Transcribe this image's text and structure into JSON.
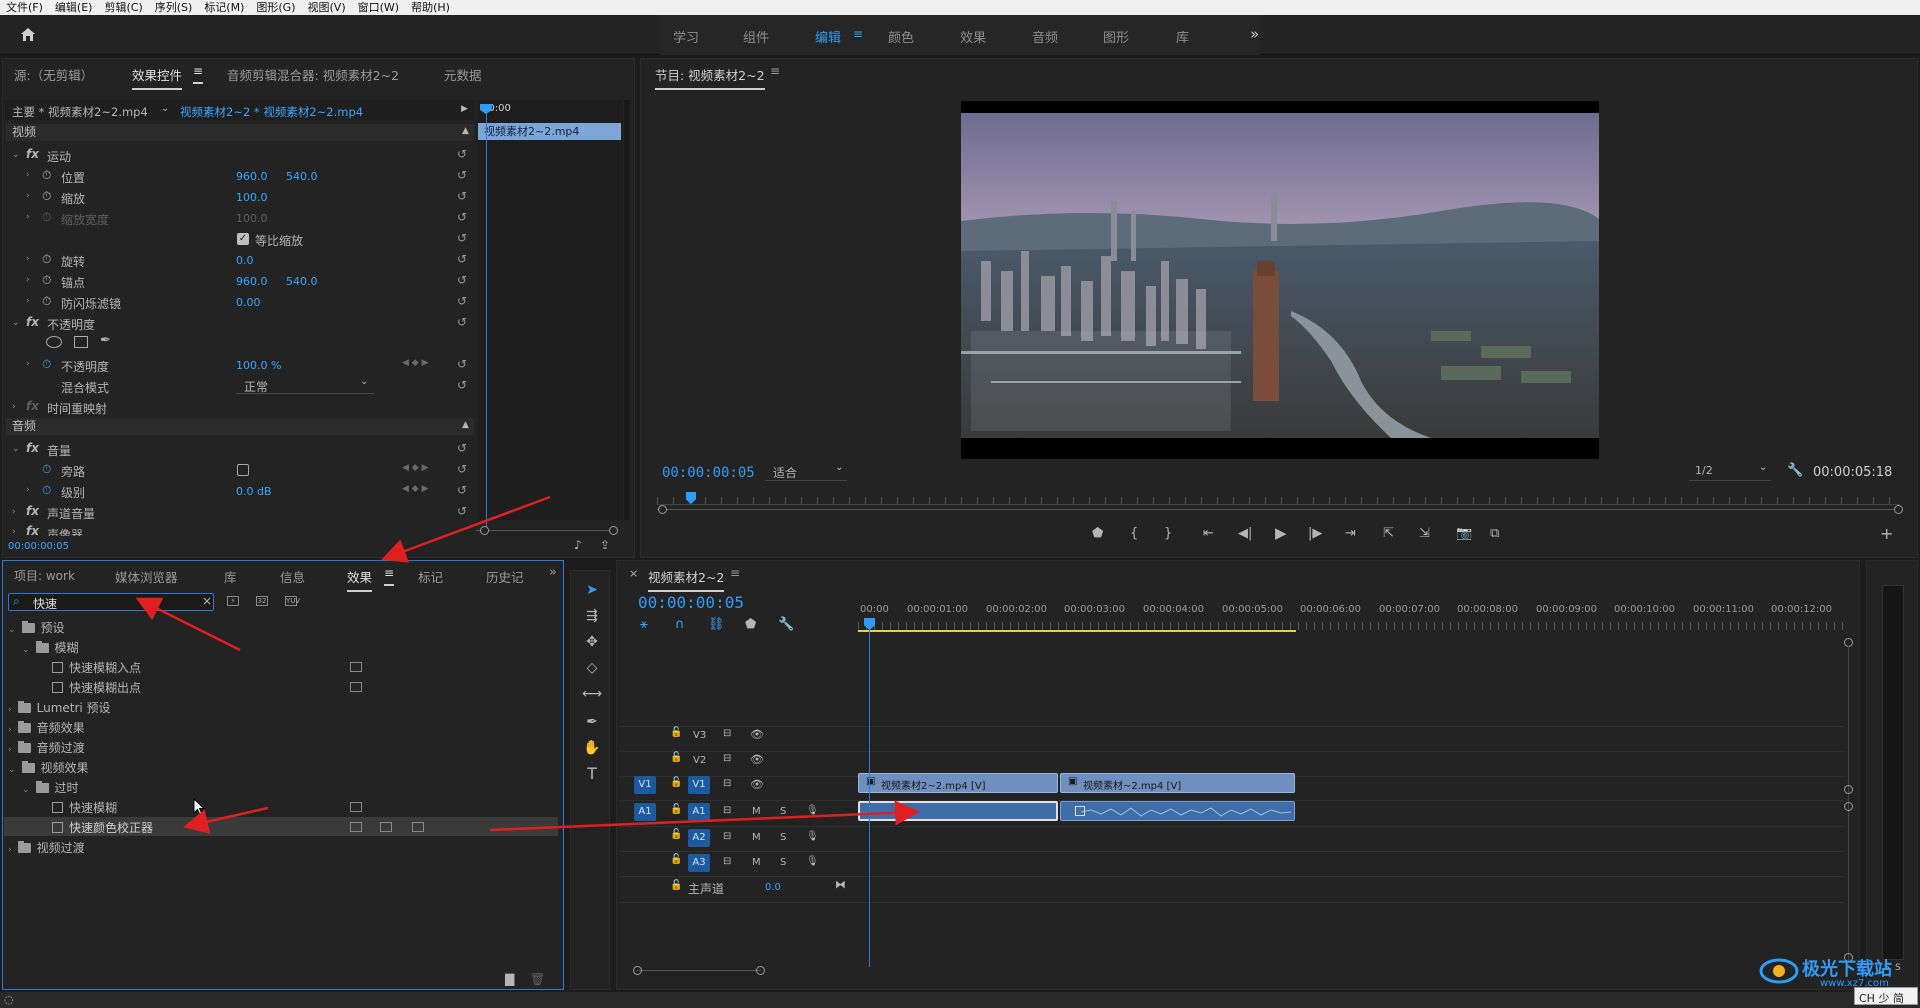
{
  "menu": [
    "文件(F)",
    "编辑(E)",
    "剪辑(C)",
    "序列(S)",
    "标记(M)",
    "图形(G)",
    "视图(V)",
    "窗口(W)",
    "帮助(H)"
  ],
  "workspaces": {
    "tabs": [
      "学习",
      "组件",
      "编辑",
      "颜色",
      "效果",
      "音频",
      "图形",
      "库"
    ],
    "active": "编辑",
    "more": "»"
  },
  "effect_panel": {
    "tabs": {
      "source": "源:（无剪辑）",
      "effect_controls": "效果控件",
      "audio_mixer": "音频剪辑混合器: 视频素材2~2",
      "metadata": "元数据"
    },
    "master": "主要 * 视频素材2~2.mp4",
    "clip_ref": "视频素材2~2 * 视频素材2~2.mp4",
    "mini_tc": "00:00",
    "mini_clip": "视频素材2~2.mp4",
    "video_header": "视频",
    "audio_header": "音频",
    "motion": "运动",
    "position": "位置",
    "pos_x": "960.0",
    "pos_y": "540.0",
    "scale": "缩放",
    "scale_val": "100.0",
    "scale_width": "缩放宽度",
    "scale_width_val": "100.0",
    "uniform": "等比缩放",
    "rotation": "旋转",
    "rotation_val": "0.0",
    "anchor": "锚点",
    "anchor_x": "960.0",
    "anchor_y": "540.0",
    "flicker": "防闪烁滤镜",
    "flicker_val": "0.00",
    "opacity": "不透明度",
    "opacity_prop": "不透明度",
    "opacity_val": "100.0 %",
    "blend": "混合模式",
    "blend_val": "正常",
    "time_remap": "时间重映射",
    "volume": "音量",
    "bypass": "旁路",
    "level": "级别",
    "level_val": "0.0 dB",
    "channel_vol": "声道音量",
    "panner": "声像器",
    "timecode": "00:00:00:05"
  },
  "program": {
    "title": "节目: 视频素材2~2",
    "timecode": "00:00:00:05",
    "fit": "适合",
    "res": "1/2",
    "duration": "00:00:05:18"
  },
  "project": {
    "tabs": [
      "项目: work",
      "媒体浏览器",
      "库",
      "信息",
      "效果",
      "标记",
      "历史记"
    ],
    "active_tab": "效果",
    "search": "快速",
    "tree": [
      {
        "label": "预设",
        "indent": 0,
        "type": "folder",
        "open": true
      },
      {
        "label": "模糊",
        "indent": 1,
        "type": "folder",
        "open": true
      },
      {
        "label": "快速模糊入点",
        "indent": 2,
        "type": "fx"
      },
      {
        "label": "快速模糊出点",
        "indent": 2,
        "type": "fx"
      },
      {
        "label": "Lumetri 预设",
        "indent": 0,
        "type": "folder",
        "open": false
      },
      {
        "label": "音频效果",
        "indent": 0,
        "type": "folder",
        "open": false
      },
      {
        "label": "音频过渡",
        "indent": 0,
        "type": "folder",
        "open": false
      },
      {
        "label": "视频效果",
        "indent": 0,
        "type": "folder",
        "open": true
      },
      {
        "label": "过时",
        "indent": 1,
        "type": "folder",
        "open": true
      },
      {
        "label": "快速模糊",
        "indent": 2,
        "type": "fx"
      },
      {
        "label": "快速颜色校正器",
        "indent": 2,
        "type": "fx",
        "selected": true
      },
      {
        "label": "视频过渡",
        "indent": 0,
        "type": "folder",
        "open": false
      }
    ]
  },
  "timeline": {
    "title": "视频素材2~2",
    "timecode": "00:00:00:05",
    "ruler": [
      "00:00",
      "00:00:01:00",
      "00:00:02:00",
      "00:00:03:00",
      "00:00:04:00",
      "00:00:05:00",
      "00:00:06:00",
      "00:00:07:00",
      "00:00:08:00",
      "00:00:09:00",
      "00:00:10:00",
      "00:00:11:00",
      "00:00:12:00"
    ],
    "tracks": {
      "v3": "V3",
      "v2": "V2",
      "v1": "V1",
      "a1": "A1",
      "a2": "A2",
      "a3": "A3",
      "src_v1": "V1",
      "src_a1": "A1",
      "m": "M",
      "s": "S",
      "master": "主声道",
      "master_val": "0.0"
    },
    "clips": {
      "v1a": "视频素材2~2.mp4 [V]",
      "v1b": "视频素材~2.mp4 [V]"
    }
  },
  "meter": {
    "s1": "S",
    "s2": "S"
  },
  "status": {
    "ime": "CH 少 简"
  },
  "watermark": {
    "name": "极光下载站",
    "url": "www.xz7.com"
  }
}
